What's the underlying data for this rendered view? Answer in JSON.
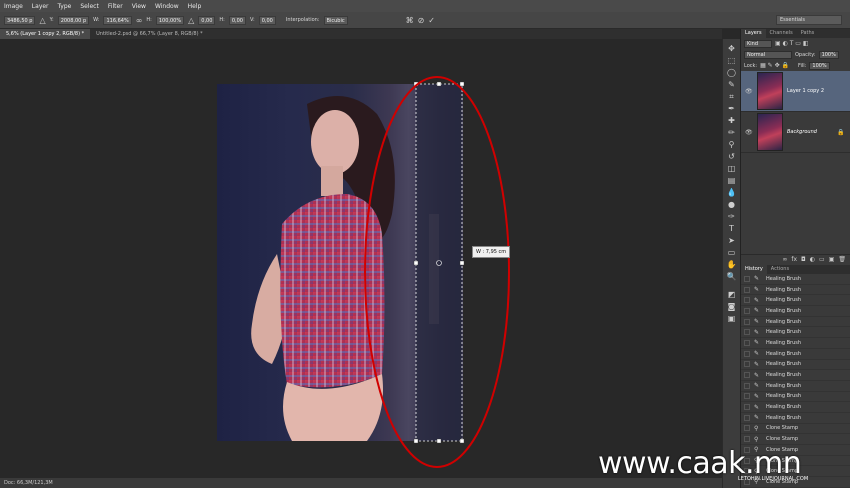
{
  "menu": [
    "Image",
    "Layer",
    "Type",
    "Select",
    "Filter",
    "View",
    "Window",
    "Help"
  ],
  "options": {
    "x_value": "3486,50 p",
    "y_value": "2008,00 p",
    "w_label": "W:",
    "w_value": "116,64%",
    "h_label": "H:",
    "h_value": "100,00%",
    "angle_value": "0,00",
    "hskew_label": "H:",
    "hskew_value": "0,00",
    "vskew_label": "V:",
    "vskew_value": "0,00",
    "interp_label": "Interpolation:",
    "interp_value": "Bicubic",
    "workspace": "Essentials"
  },
  "doc_tabs": [
    {
      "label": "5,6% (Layer 1 copy 2, RGB/8) *"
    },
    {
      "label": "Untitled-2.psd @ 66,7% (Layer 8, RGB/8) *"
    }
  ],
  "transform": {
    "tooltip": "W : 7,95 cm"
  },
  "status": "Doc: 66,3M/121,3M",
  "layers_panel": {
    "tabs": [
      "Layers",
      "Channels",
      "Paths"
    ],
    "kind": "Kind",
    "blend_mode": "Normal",
    "opacity_label": "Opacity:",
    "opacity_value": "100%",
    "lock_label": "Lock:",
    "fill_label": "Fill:",
    "fill_value": "100%",
    "layers": [
      {
        "name": "Layer 1 copy 2",
        "active": true
      },
      {
        "name": "Background",
        "active": false
      }
    ]
  },
  "history_panel": {
    "tabs": [
      "History",
      "Actions"
    ],
    "items": [
      "Healing Brush",
      "Healing Brush",
      "Healing Brush",
      "Healing Brush",
      "Healing Brush",
      "Healing Brush",
      "Healing Brush",
      "Healing Brush",
      "Healing Brush",
      "Healing Brush",
      "Healing Brush",
      "Healing Brush",
      "Healing Brush",
      "Healing Brush",
      "Clone Stamp",
      "Clone Stamp",
      "Clone Stamp",
      "Clone Stamp",
      "Clone Stamp",
      "Clone Stamp"
    ]
  },
  "watermark_small": "LETOHIN.LIVEJOURNAL.COM",
  "watermark": "www.caak.mn",
  "colors": {
    "annotation": "#d00000",
    "layer_selected": "#56657d"
  }
}
